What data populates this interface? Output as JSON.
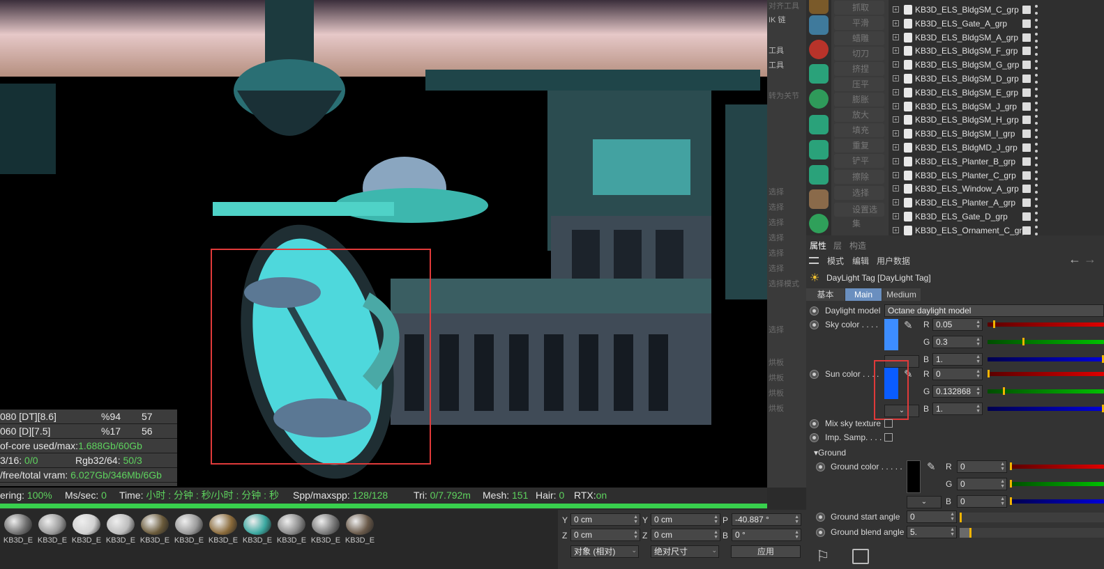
{
  "viewport": {
    "stats": {
      "rows": [
        {
          "a": "080 [DT][8.6]",
          "b": "%94",
          "c": "57"
        },
        {
          "a": "060 [D][7.5]",
          "b": "%17",
          "c": "56"
        }
      ],
      "ooc_label": "of-core used/max:",
      "ooc_value": "1.688Gb/60Gb",
      "tex_label": "3/16:",
      "tex_value": "0/0",
      "rgb_label": "Rgb32/64:",
      "rgb_value": "50/3",
      "vram_label": "/free/total vram:",
      "vram_value": "6.027Gb/346Mb/6Gb"
    },
    "status": {
      "rendering_label": "ering:",
      "rendering_value": "100%",
      "ms_label": "Ms/sec:",
      "ms_value": "0",
      "time_label": "Time:",
      "time_value": "小时 : 分钟 : 秒/小时 : 分钟 : 秒",
      "spp_label": "Spp/maxspp:",
      "spp_value": "128/128",
      "tri_label": "Tri:",
      "tri_value": "0/7.792m",
      "mesh_label": "Mesh:",
      "mesh_value": "151",
      "hair_label": "Hair:",
      "hair_value": "0",
      "rtx_label": "RTX:",
      "rtx_value": "on"
    },
    "progress": 1.0
  },
  "materials": [
    "KB3D_E",
    "KB3D_E",
    "KB3D_E",
    "KB3D_E",
    "KB3D_E",
    "KB3D_E",
    "KB3D_E",
    "KB3D_E",
    "KB3D_E",
    "KB3D_E",
    "KB3D_E"
  ],
  "midstrip": {
    "top_items": [
      "对齐工具",
      "IK 链",
      "工具",
      "工具",
      "转为关节"
    ],
    "select_items": [
      "选择",
      "选择",
      "选择",
      "选择",
      "选择",
      "选择",
      "选择...",
      "选择模式",
      "选择"
    ],
    "bake_items": [
      "烘板",
      "烘板",
      "烘板",
      "烘板"
    ]
  },
  "tools": [
    "抓取",
    "平滑",
    "蜡雕",
    "切刀",
    "挤捏",
    "压平",
    "膨胀",
    "放大",
    "填充",
    "重复",
    "铲平",
    "擦除",
    "选择",
    "设置选集"
  ],
  "objects": [
    "KB3D_ELS_BldgSM_C_grp",
    "KB3D_ELS_Gate_A_grp",
    "KB3D_ELS_BldgSM_A_grp",
    "KB3D_ELS_BldgSM_F_grp",
    "KB3D_ELS_BldgSM_G_grp",
    "KB3D_ELS_BldgSM_D_grp",
    "KB3D_ELS_BldgSM_E_grp",
    "KB3D_ELS_BldgSM_J_grp",
    "KB3D_ELS_BldgSM_H_grp",
    "KB3D_ELS_BldgSM_I_grp",
    "KB3D_ELS_BldgMD_J_grp",
    "KB3D_ELS_Planter_B_grp",
    "KB3D_ELS_Planter_C_grp",
    "KB3D_ELS_Window_A_grp",
    "KB3D_ELS_Planter_A_grp",
    "KB3D_ELS_Gate_D_grp",
    "KB3D_ELS_Ornament_C_grp"
  ],
  "attributes": {
    "tabs": [
      "属性",
      "层",
      "构造"
    ],
    "menu": [
      "模式",
      "编辑",
      "用户数据"
    ],
    "tag_title": "DayLight Tag [DayLight Tag]",
    "subtabs": [
      "基本",
      "Main",
      "Medium"
    ],
    "daylight_model_label": "Daylight model",
    "daylight_model_value": "Octane daylight model",
    "sky_color_label": "Sky color . . . .",
    "sky": {
      "r": "0.05",
      "g": "0.3",
      "b": "1.",
      "r_level": 0.05,
      "g_level": 0.3,
      "b_level": 1.0,
      "swatch": "#3d8dff"
    },
    "sun_color_label": "Sun color . . . .",
    "sun": {
      "r": "0",
      "g": "0.132868",
      "b": "1.",
      "r_level": 0.0,
      "g_level": 0.13,
      "b_level": 1.0,
      "swatch": "#0a5cff"
    },
    "mix_sky_label": "Mix sky texture",
    "imp_samp_label": "Imp. Samp. . . .",
    "ground_section": "Ground",
    "ground_color_label": "Ground color . . . . .",
    "ground": {
      "r": "0",
      "g": "0",
      "b": "0",
      "swatch": "#000000"
    },
    "ground_start_label": "Ground start angle",
    "ground_start_value": "0",
    "ground_blend_label": "Ground blend angle",
    "ground_blend_value": "5.",
    "channel_r": "R",
    "channel_g": "G",
    "channel_b": "B"
  },
  "coords": {
    "y_label": "Y",
    "y_pos": "0 cm",
    "y2_label": "Y",
    "y_size": "0 cm",
    "p_label": "P",
    "p_val": "-40.887 °",
    "z_label": "Z",
    "z_pos": "0 cm",
    "z2_label": "Z",
    "z_size": "0 cm",
    "b_label": "B",
    "b_val": "0 °",
    "mode_select": "对象 (相对)",
    "size_select": "绝对尺寸",
    "apply": "应用"
  }
}
